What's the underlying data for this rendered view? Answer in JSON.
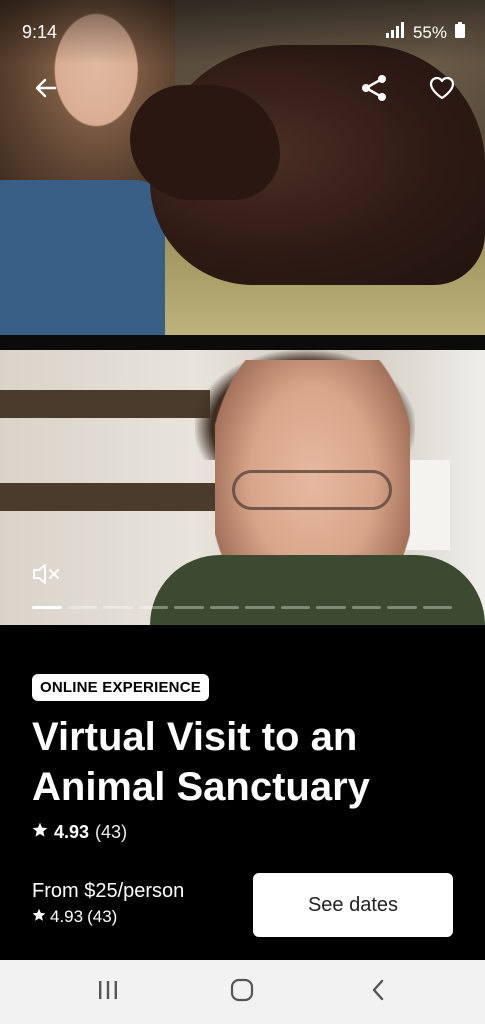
{
  "status_bar": {
    "time": "9:14",
    "battery": "55%"
  },
  "top_actions": {
    "back_icon": "arrow-left-icon",
    "share_icon": "share-icon",
    "favorite_icon": "heart-outline-icon"
  },
  "media": {
    "mute_icon": "volume-muted-icon",
    "progress_segments": 12,
    "active_segment": 1
  },
  "listing": {
    "badge": "ONLINE EXPERIENCE",
    "title": "Virtual Visit to an Animal Sanctuary",
    "rating": "4.93",
    "reviews": "(43)"
  },
  "footer": {
    "price": "From $25/person",
    "rating": "4.93",
    "reviews": "(43)",
    "cta": "See dates"
  },
  "nav_bar": {
    "recents_icon": "recent-apps-icon",
    "home_icon": "home-circle-icon",
    "back_icon": "chevron-left-icon"
  }
}
